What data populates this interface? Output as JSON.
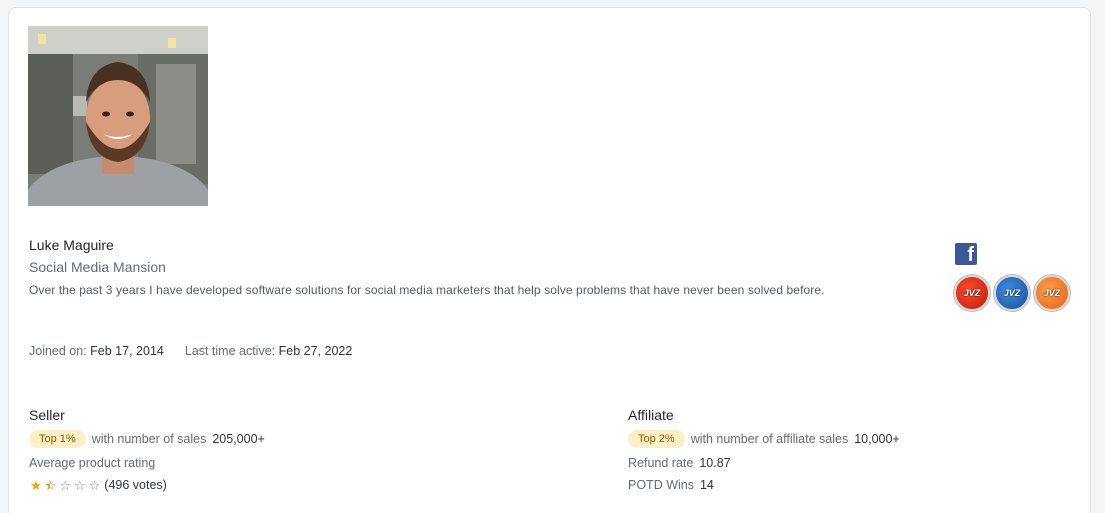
{
  "profile": {
    "name": "Luke Maguire",
    "company": "Social Media Mansion",
    "bio": "Over the past 3 years I have developed software solutions for social media marketers that help solve problems that have never been solved before.",
    "joined_label": "Joined on:",
    "joined_value": "Feb 17, 2014",
    "active_label": "Last time active:",
    "active_value": "Feb 27, 2022"
  },
  "social": {
    "facebook_icon": "facebook-icon",
    "facebook_glyph": "f"
  },
  "badges": [
    {
      "icon": "jvzoo-badge-red",
      "color": "#d42211"
    },
    {
      "icon": "jvzoo-badge-blue",
      "color": "#1f5fae"
    },
    {
      "icon": "jvzoo-badge-orange",
      "color": "#f07a22"
    }
  ],
  "seller": {
    "title": "Seller",
    "rank_pill": "Top 1%",
    "sales_label": "with number of sales",
    "sales_value": "205,000+",
    "rating_label": "Average product rating",
    "rating_stars": 1.5,
    "rating_max": 5,
    "votes": "(496 votes)"
  },
  "affiliate": {
    "title": "Affiliate",
    "rank_pill": "Top 2%",
    "sales_label": "with number of affiliate sales",
    "sales_value": "10,000+",
    "refund_label": "Refund rate",
    "refund_value": "10.87",
    "potd_label": "POTD Wins",
    "potd_value": "14"
  }
}
